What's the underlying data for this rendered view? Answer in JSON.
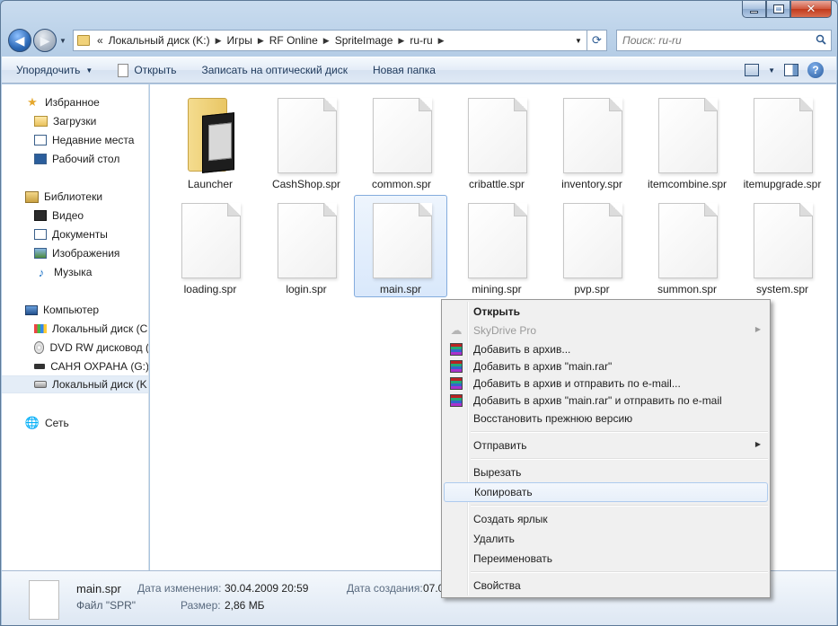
{
  "window": {
    "controls": {
      "minimize": "minimize",
      "maximize": "maximize",
      "close": "close"
    }
  },
  "address": {
    "prefix": "«",
    "crumbs": [
      "Локальный диск (K:)",
      "Игры",
      "RF Online",
      "SpriteImage",
      "ru-ru"
    ],
    "search_placeholder": "Поиск: ru-ru"
  },
  "toolbar": {
    "organize": "Упорядочить",
    "open": "Открыть",
    "burn": "Записать на оптический диск",
    "new_folder": "Новая папка"
  },
  "sidebar": {
    "favorites": "Избранное",
    "downloads": "Загрузки",
    "recent": "Недавние места",
    "desktop": "Рабочий стол",
    "libraries": "Библиотеки",
    "video": "Видео",
    "documents": "Документы",
    "images": "Изображения",
    "music": "Музыка",
    "computer": "Компьютер",
    "drive_c": "Локальный диск (C",
    "dvd": "DVD RW дисковод (",
    "drive_g": "САНЯ ОХРАНА (G:)",
    "drive_k": "Локальный диск (K",
    "network": "Сеть"
  },
  "files": [
    "Launcher",
    "CashShop.spr",
    "common.spr",
    "cribattle.spr",
    "inventory.spr",
    "itemcombine.spr",
    "itemupgrade.spr",
    "loading.spr",
    "login.spr",
    "main.spr",
    "mining.spr",
    "pvp.spr",
    "summon.spr",
    "system.spr"
  ],
  "details": {
    "name": "main.spr",
    "type": "Файл \"SPR\"",
    "modified_label": "Дата изменения:",
    "modified_value": "30.04.2009 20:59",
    "size_label": "Размер:",
    "size_value": "2,86 МБ",
    "created_label": "Дата создания:",
    "created_value": "07.0"
  },
  "context_menu": {
    "open": "Открыть",
    "skydrive": "SkyDrive Pro",
    "add_archive": "Добавить в архив...",
    "add_main_rar": "Добавить в архив \"main.rar\"",
    "add_email": "Добавить в архив и отправить по e-mail...",
    "add_main_email": "Добавить в архив \"main.rar\" и отправить по e-mail",
    "restore": "Восстановить прежнюю версию",
    "send_to": "Отправить",
    "cut": "Вырезать",
    "copy": "Копировать",
    "shortcut": "Создать ярлык",
    "delete": "Удалить",
    "rename": "Переименовать",
    "properties": "Свойства"
  }
}
